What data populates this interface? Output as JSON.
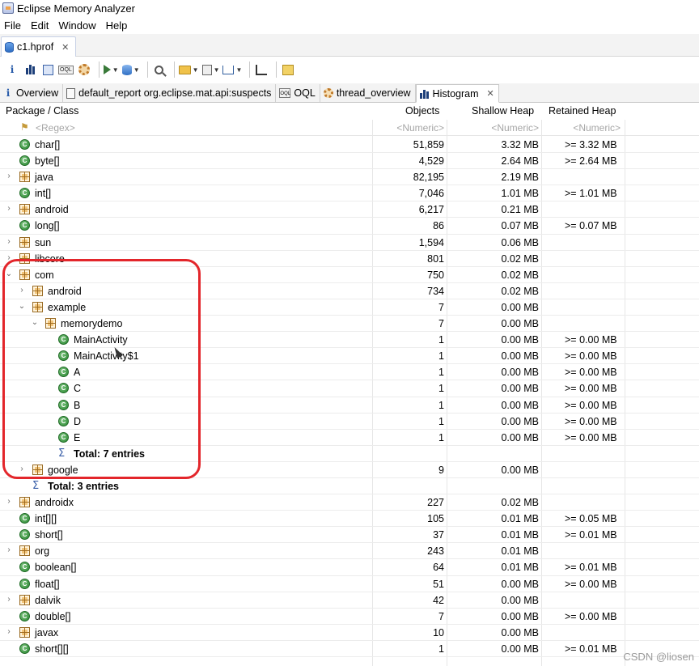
{
  "window": {
    "title": "Eclipse Memory Analyzer"
  },
  "menu": [
    "File",
    "Edit",
    "Window",
    "Help"
  ],
  "editor_tab": {
    "label": "c1.hprof",
    "close": "✕"
  },
  "toolbar_icons": [
    "info-icon",
    "histogram-icon",
    "dominator-tree-icon",
    "oql-icon",
    "gear-icon",
    "run-report-icon",
    "heap-dump-icon",
    "search-icon",
    "group-icon",
    "calculator-icon",
    "export-icon",
    "bar-chart-icon",
    "gift-icon"
  ],
  "view_tabs": [
    {
      "label": "Overview",
      "icon": "info-icon"
    },
    {
      "label": "default_report  org.eclipse.mat.api:suspects",
      "icon": "report-icon"
    },
    {
      "label": "OQL",
      "icon": "oql-icon"
    },
    {
      "label": "thread_overview",
      "icon": "gear-icon"
    },
    {
      "label": "Histogram",
      "icon": "histogram-icon",
      "close": "✕"
    }
  ],
  "columns": {
    "name": "Package / Class",
    "objects": "Objects",
    "shallow": "Shallow Heap",
    "retained": "Retained Heap"
  },
  "filters": {
    "name": "<Regex>",
    "objects": "<Numeric>",
    "shallow": "<Numeric>",
    "retained": "<Numeric>"
  },
  "rows": [
    {
      "indent": 0,
      "twist": "",
      "type": "cls",
      "name": "char[]",
      "objects": "51,859",
      "shallow": "3.32 MB",
      "retained": ">= 3.32 MB"
    },
    {
      "indent": 0,
      "twist": "",
      "type": "cls",
      "name": "byte[]",
      "objects": "4,529",
      "shallow": "2.64 MB",
      "retained": ">= 2.64 MB"
    },
    {
      "indent": 0,
      "twist": ">",
      "type": "pkg",
      "name": "java",
      "objects": "82,195",
      "shallow": "2.19 MB",
      "retained": ""
    },
    {
      "indent": 0,
      "twist": "",
      "type": "cls",
      "name": "int[]",
      "objects": "7,046",
      "shallow": "1.01 MB",
      "retained": ">= 1.01 MB"
    },
    {
      "indent": 0,
      "twist": ">",
      "type": "pkg",
      "name": "android",
      "objects": "6,217",
      "shallow": "0.21 MB",
      "retained": ""
    },
    {
      "indent": 0,
      "twist": "",
      "type": "cls",
      "name": "long[]",
      "objects": "86",
      "shallow": "0.07 MB",
      "retained": ">= 0.07 MB"
    },
    {
      "indent": 0,
      "twist": ">",
      "type": "pkg",
      "name": "sun",
      "objects": "1,594",
      "shallow": "0.06 MB",
      "retained": ""
    },
    {
      "indent": 0,
      "twist": ">",
      "type": "pkg",
      "name": "libcore",
      "objects": "801",
      "shallow": "0.02 MB",
      "retained": ""
    },
    {
      "indent": 0,
      "twist": "v",
      "type": "pkg",
      "name": "com",
      "objects": "750",
      "shallow": "0.02 MB",
      "retained": ""
    },
    {
      "indent": 1,
      "twist": ">",
      "type": "pkg",
      "name": "android",
      "objects": "734",
      "shallow": "0.02 MB",
      "retained": ""
    },
    {
      "indent": 1,
      "twist": "v",
      "type": "pkg",
      "name": "example",
      "objects": "7",
      "shallow": "0.00 MB",
      "retained": ""
    },
    {
      "indent": 2,
      "twist": "v",
      "type": "pkg",
      "name": "memorydemo",
      "objects": "7",
      "shallow": "0.00 MB",
      "retained": ""
    },
    {
      "indent": 3,
      "twist": "",
      "type": "cls",
      "name": "MainActivity",
      "objects": "1",
      "shallow": "0.00 MB",
      "retained": ">= 0.00 MB"
    },
    {
      "indent": 3,
      "twist": "",
      "type": "cls",
      "name": "MainActivity$1",
      "objects": "1",
      "shallow": "0.00 MB",
      "retained": ">= 0.00 MB"
    },
    {
      "indent": 3,
      "twist": "",
      "type": "cls",
      "name": "A",
      "objects": "1",
      "shallow": "0.00 MB",
      "retained": ">= 0.00 MB"
    },
    {
      "indent": 3,
      "twist": "",
      "type": "cls",
      "name": "C",
      "objects": "1",
      "shallow": "0.00 MB",
      "retained": ">= 0.00 MB"
    },
    {
      "indent": 3,
      "twist": "",
      "type": "cls",
      "name": "B",
      "objects": "1",
      "shallow": "0.00 MB",
      "retained": ">= 0.00 MB"
    },
    {
      "indent": 3,
      "twist": "",
      "type": "cls",
      "name": "D",
      "objects": "1",
      "shallow": "0.00 MB",
      "retained": ">= 0.00 MB"
    },
    {
      "indent": 3,
      "twist": "",
      "type": "cls",
      "name": "E",
      "objects": "1",
      "shallow": "0.00 MB",
      "retained": ">= 0.00 MB"
    },
    {
      "indent": 3,
      "twist": "",
      "type": "sum",
      "name": "Total: 7 entries",
      "objects": "",
      "shallow": "",
      "retained": ""
    },
    {
      "indent": 1,
      "twist": ">",
      "type": "pkg",
      "name": "google",
      "objects": "9",
      "shallow": "0.00 MB",
      "retained": ""
    },
    {
      "indent": 1,
      "twist": "",
      "type": "sum",
      "name": "Total: 3 entries",
      "objects": "",
      "shallow": "",
      "retained": ""
    },
    {
      "indent": 0,
      "twist": ">",
      "type": "pkg",
      "name": "androidx",
      "objects": "227",
      "shallow": "0.02 MB",
      "retained": ""
    },
    {
      "indent": 0,
      "twist": "",
      "type": "cls",
      "name": "int[][]",
      "objects": "105",
      "shallow": "0.01 MB",
      "retained": ">= 0.05 MB"
    },
    {
      "indent": 0,
      "twist": "",
      "type": "cls",
      "name": "short[]",
      "objects": "37",
      "shallow": "0.01 MB",
      "retained": ">= 0.01 MB"
    },
    {
      "indent": 0,
      "twist": ">",
      "type": "pkg",
      "name": "org",
      "objects": "243",
      "shallow": "0.01 MB",
      "retained": ""
    },
    {
      "indent": 0,
      "twist": "",
      "type": "cls",
      "name": "boolean[]",
      "objects": "64",
      "shallow": "0.01 MB",
      "retained": ">= 0.01 MB"
    },
    {
      "indent": 0,
      "twist": "",
      "type": "cls",
      "name": "float[]",
      "objects": "51",
      "shallow": "0.00 MB",
      "retained": ">= 0.00 MB"
    },
    {
      "indent": 0,
      "twist": ">",
      "type": "pkg",
      "name": "dalvik",
      "objects": "42",
      "shallow": "0.00 MB",
      "retained": ""
    },
    {
      "indent": 0,
      "twist": "",
      "type": "cls",
      "name": "double[]",
      "objects": "7",
      "shallow": "0.00 MB",
      "retained": ">= 0.00 MB"
    },
    {
      "indent": 0,
      "twist": ">",
      "type": "pkg",
      "name": "javax",
      "objects": "10",
      "shallow": "0.00 MB",
      "retained": ""
    },
    {
      "indent": 0,
      "twist": "",
      "type": "cls",
      "name": "short[][]",
      "objects": "1",
      "shallow": "0.00 MB",
      "retained": ">= 0.01 MB"
    }
  ],
  "watermark": "CSDN @liosen",
  "highlight_color": "#e3262b"
}
